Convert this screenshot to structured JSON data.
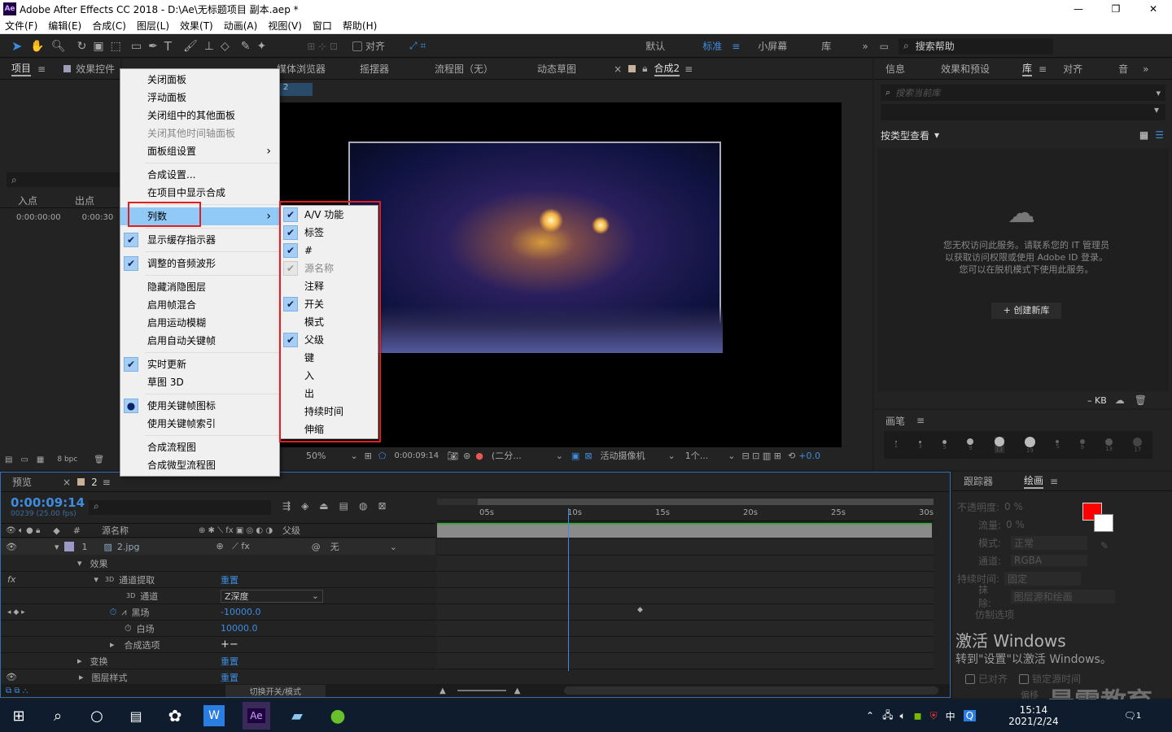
{
  "titlebar": {
    "app_icon": "Ae",
    "title": "Adobe After Effects CC 2018 - D:\\Ae\\无标题项目 副本.aep *",
    "minimize": "—",
    "maximize": "❐",
    "close": "✕"
  },
  "menubar": [
    "文件(F)",
    "编辑(E)",
    "合成(C)",
    "图层(L)",
    "效果(T)",
    "动画(A)",
    "视图(V)",
    "窗口",
    "帮助(H)"
  ],
  "toolbar": {
    "snap_label": "对齐",
    "workspaces": [
      "默认",
      "标准",
      "小屏幕",
      "库"
    ],
    "active_workspace": "标准",
    "search_help": "搜索帮助",
    "more": "»"
  },
  "project_panel": {
    "tab": "项目",
    "effects_tab": "效果控件",
    "col_in": "入点",
    "col_out": "出点",
    "in_value": "0:00:00:00",
    "out_value": "0:00:30",
    "bpc": "8 bpc"
  },
  "viewer": {
    "tabs": [
      "媒体浏览器",
      "摇摆器",
      "流程图（无）",
      "动态草图",
      "合成2"
    ],
    "comp_chip": "2",
    "zoom": "50%",
    "timecode": "0:00:09:14",
    "resolution": "(二分...",
    "camera": "活动摄像机",
    "views": "1个...",
    "exposure": "+0.0"
  },
  "right_panel": {
    "tabs": [
      "信息",
      "效果和预设",
      "库",
      "对齐",
      "音"
    ],
    "search_placeholder": "搜索当前库",
    "view_by": "按类型查看",
    "message": "您无权访问此服务。请联系您的 IT 管理员以获取访问权限或使用 Adobe ID 登录。您可以在脱机模式下使用此服务。",
    "create_lib": "+ 创建新库",
    "kb": "– KB",
    "brush_tab": "画笔",
    "brush_sizes": [
      "1",
      "3",
      "5",
      "9",
      "13",
      "19",
      "5",
      "9",
      "13",
      "17"
    ]
  },
  "context_menu": {
    "items": [
      {
        "label": "关闭面板",
        "checked": false
      },
      {
        "label": "浮动面板",
        "checked": false
      },
      {
        "label": "关闭组中的其他面板",
        "checked": false
      },
      {
        "label": "关闭其他时间轴面板",
        "checked": false,
        "disabled": true
      },
      {
        "label": "面板组设置",
        "checked": false,
        "submenu": true
      },
      {
        "sep": true
      },
      {
        "label": "合成设置...",
        "checked": false
      },
      {
        "label": "在项目中显示合成",
        "checked": false
      },
      {
        "sep": true
      },
      {
        "label": "列数",
        "checked": false,
        "submenu": true,
        "highlight": true
      },
      {
        "sep": true
      },
      {
        "label": "显示缓存指示器",
        "checked": true
      },
      {
        "sep": true
      },
      {
        "label": "调整的音频波形",
        "checked": true
      },
      {
        "sep": true
      },
      {
        "label": "隐藏消隐图层",
        "checked": false
      },
      {
        "label": "启用帧混合",
        "checked": false
      },
      {
        "label": "启用运动模糊",
        "checked": false
      },
      {
        "label": "启用自动关键帧",
        "checked": false
      },
      {
        "sep": true
      },
      {
        "label": "实时更新",
        "checked": true
      },
      {
        "label": "草图 3D",
        "checked": false
      },
      {
        "sep": true
      },
      {
        "label": "使用关键帧图标",
        "checked": true,
        "dot": true
      },
      {
        "label": "使用关键帧索引",
        "checked": false
      },
      {
        "sep": true
      },
      {
        "label": "合成流程图",
        "checked": false
      },
      {
        "label": "合成微型流程图",
        "checked": false
      }
    ]
  },
  "submenu": {
    "items": [
      {
        "label": "A/V 功能",
        "checked": true
      },
      {
        "label": "标签",
        "checked": true
      },
      {
        "label": "#",
        "checked": true
      },
      {
        "label": "源名称",
        "checked": true,
        "disabled": true
      },
      {
        "label": "注释",
        "checked": false
      },
      {
        "label": "开关",
        "checked": true
      },
      {
        "label": "模式",
        "checked": false
      },
      {
        "label": "父级",
        "checked": true
      },
      {
        "label": "键",
        "checked": false
      },
      {
        "label": "入",
        "checked": false
      },
      {
        "label": "出",
        "checked": false
      },
      {
        "label": "持续时间",
        "checked": false
      },
      {
        "label": "伸缩",
        "checked": false
      }
    ]
  },
  "timeline": {
    "tab_preview": "预览",
    "tab_comp": "2",
    "timecode": "0:00:09:14",
    "fps": "00239 (25.00 fps)",
    "col_source": "源名称",
    "col_parent": "父级",
    "ruler": [
      "05s",
      "10s",
      "15s",
      "20s",
      "25s",
      "30s"
    ],
    "playhead_fraction": 0.3,
    "layer": {
      "index": "1",
      "name": "2.jpg",
      "parent": "无"
    },
    "rows": [
      {
        "label": "效果",
        "value": ""
      },
      {
        "label": "通道提取",
        "value": "重置",
        "prefix": "3D"
      },
      {
        "label": "通道",
        "value": "Z深度",
        "prefix": "3D"
      },
      {
        "label": "黑场",
        "value": "-10000.0"
      },
      {
        "label": "白场",
        "value": "10000.0"
      },
      {
        "label": "合成选项",
        "value": "+−"
      },
      {
        "label": "变换",
        "value": "重置"
      },
      {
        "label": "图层样式",
        "value": "重置"
      }
    ],
    "footer": "切换开关/模式"
  },
  "tracker": {
    "tabs": [
      "跟踪器",
      "绘画"
    ],
    "rows": [
      [
        "不透明度:",
        "0 %"
      ],
      [
        "流量:",
        "0 %"
      ],
      [
        "模式:",
        "正常"
      ],
      [
        "通道:",
        "RGBA"
      ],
      [
        "持续时间:",
        "固定"
      ],
      [
        "抹除:",
        "图层源和绘画"
      ],
      [
        "仿制选项",
        ""
      ]
    ],
    "checks": [
      "已对齐",
      "锁定源时间"
    ],
    "offset": "偏移",
    "swatch_color": "#ff0000"
  },
  "watermark": {
    "line1": "激活 Windows",
    "line2": "转到\"设置\"以激活 Windows。",
    "brand": "最需教育"
  },
  "taskbar": {
    "time": "15:14",
    "date": "2021/2/24",
    "ime": "中",
    "ae": "Ae",
    "notif": "1"
  }
}
